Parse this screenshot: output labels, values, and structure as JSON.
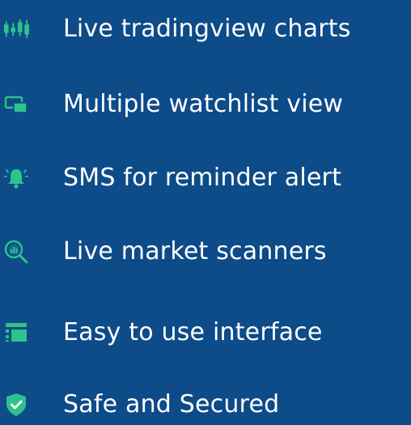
{
  "colors": {
    "background": "#0d4b89",
    "text": "#ffffff",
    "icon_green": "#2fc28b",
    "icon_green_light": "#7fe1bb"
  },
  "features": [
    {
      "icon": "candlestick-chart-icon",
      "label": "Live tradingview charts"
    },
    {
      "icon": "multi-window-icon",
      "label": "Multiple watchlist view"
    },
    {
      "icon": "alarm-bell-icon",
      "label": "SMS for reminder alert"
    },
    {
      "icon": "magnifier-chart-icon",
      "label": "Live market scanners"
    },
    {
      "icon": "layout-list-icon",
      "label": "Easy to use interface"
    },
    {
      "icon": "shield-check-icon",
      "label": "Safe and Secured"
    }
  ]
}
